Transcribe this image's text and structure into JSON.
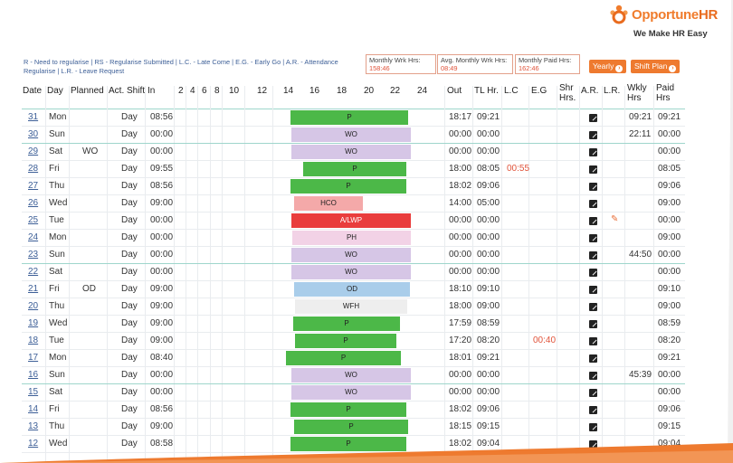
{
  "brand": {
    "name_main": "Opportune",
    "name_hr": "HR",
    "tagline": "We Make HR Easy"
  },
  "legend": "R - Need to regularise | RS - Regularise Submitted | L.C. - Late Come | E.G. - Early Go | A.R. - Attendance Regularise | L.R. - Leave Request",
  "stats": [
    {
      "label": "Monthly Wrk Hrs:",
      "value": "158:46"
    },
    {
      "label": "Avg. Monthly Wrk Hrs:",
      "value": "08:49"
    },
    {
      "label": "Monthly Paid Hrs:",
      "value": "162:46"
    }
  ],
  "buttons": {
    "yearly": "Yearly",
    "shift_plan": "Shift Plan",
    "arrow": "›"
  },
  "headers": {
    "date": "Date",
    "day": "Day",
    "planned": "Planned",
    "act_shift": "Act. Shift",
    "in": "In",
    "timeline": [
      "2",
      "4",
      "6",
      "8",
      "10",
      "12",
      "14",
      "16",
      "18",
      "20",
      "22",
      "24"
    ],
    "out": "Out",
    "tl_hr": "TL Hr.",
    "lc": "L.C",
    "eg": "E.G",
    "shr_hrs_1": "Shr",
    "shr_hrs_2": "Hrs.",
    "ar": "A.R.",
    "lr": "L.R.",
    "wkly_1": "Wkly",
    "wkly_2": "Hrs",
    "paid_1": "Paid",
    "paid_2": "Hrs"
  },
  "colors": {
    "P": "#4cb848",
    "WO": "#d6c6e6",
    "HCO": "#f4a9a9",
    "A/LWP": "#e93d3d",
    "PH": "#f2d2e6",
    "OD": "#a9cdea",
    "WFH": "#eeeeee"
  },
  "rows": [
    {
      "date": "31",
      "day": "Mon",
      "planned": "",
      "shift": "Day",
      "in": "08:56",
      "status": "P",
      "out": "18:17",
      "tl": "09:21",
      "lc": "",
      "eg": "",
      "ar": true,
      "lr": false,
      "wkly": "09:21",
      "paid": "09:21"
    },
    {
      "date": "30",
      "day": "Sun",
      "planned": "",
      "shift": "Day",
      "in": "00:00",
      "status": "WO",
      "out": "00:00",
      "tl": "00:00",
      "lc": "",
      "eg": "",
      "ar": true,
      "lr": false,
      "wkly": "22:11",
      "paid": "00:00"
    },
    {
      "date": "29",
      "day": "Sat",
      "planned": "WO",
      "shift": "Day",
      "in": "00:00",
      "status": "WO",
      "out": "00:00",
      "tl": "00:00",
      "lc": "",
      "eg": "",
      "ar": true,
      "lr": false,
      "wkly": "",
      "paid": "00:00"
    },
    {
      "date": "28",
      "day": "Fri",
      "planned": "",
      "shift": "Day",
      "in": "09:55",
      "status": "P",
      "out": "18:00",
      "tl": "08:05",
      "lc": "00:55",
      "eg": "",
      "ar": true,
      "lr": false,
      "wkly": "",
      "paid": "08:05"
    },
    {
      "date": "27",
      "day": "Thu",
      "planned": "",
      "shift": "Day",
      "in": "08:56",
      "status": "P",
      "out": "18:02",
      "tl": "09:06",
      "lc": "",
      "eg": "",
      "ar": true,
      "lr": false,
      "wkly": "",
      "paid": "09:06"
    },
    {
      "date": "26",
      "day": "Wed",
      "planned": "",
      "shift": "Day",
      "in": "09:00",
      "status": "HCO",
      "out": "14:00",
      "tl": "05:00",
      "lc": "",
      "eg": "",
      "ar": true,
      "lr": false,
      "wkly": "",
      "paid": "09:00"
    },
    {
      "date": "25",
      "day": "Tue",
      "planned": "",
      "shift": "Day",
      "in": "00:00",
      "status": "A/LWP",
      "out": "00:00",
      "tl": "00:00",
      "lc": "",
      "eg": "",
      "ar": true,
      "lr": true,
      "wkly": "",
      "paid": "00:00"
    },
    {
      "date": "24",
      "day": "Mon",
      "planned": "",
      "shift": "Day",
      "in": "00:00",
      "status": "PH",
      "out": "00:00",
      "tl": "00:00",
      "lc": "",
      "eg": "",
      "ar": true,
      "lr": false,
      "wkly": "",
      "paid": "09:00"
    },
    {
      "date": "23",
      "day": "Sun",
      "planned": "",
      "shift": "Day",
      "in": "00:00",
      "status": "WO",
      "out": "00:00",
      "tl": "00:00",
      "lc": "",
      "eg": "",
      "ar": true,
      "lr": false,
      "wkly": "44:50",
      "paid": "00:00"
    },
    {
      "date": "22",
      "day": "Sat",
      "planned": "",
      "shift": "Day",
      "in": "00:00",
      "status": "WO",
      "out": "00:00",
      "tl": "00:00",
      "lc": "",
      "eg": "",
      "ar": true,
      "lr": false,
      "wkly": "",
      "paid": "00:00"
    },
    {
      "date": "21",
      "day": "Fri",
      "planned": "OD",
      "shift": "Day",
      "in": "09:00",
      "status": "OD",
      "out": "18:10",
      "tl": "09:10",
      "lc": "",
      "eg": "",
      "ar": true,
      "lr": false,
      "wkly": "",
      "paid": "09:10"
    },
    {
      "date": "20",
      "day": "Thu",
      "planned": "",
      "shift": "Day",
      "in": "09:00",
      "status": "WFH",
      "out": "18:00",
      "tl": "09:00",
      "lc": "",
      "eg": "",
      "ar": true,
      "lr": false,
      "wkly": "",
      "paid": "09:00"
    },
    {
      "date": "19",
      "day": "Wed",
      "planned": "",
      "shift": "Day",
      "in": "09:00",
      "status": "P",
      "out": "17:59",
      "tl": "08:59",
      "lc": "",
      "eg": "",
      "ar": true,
      "lr": false,
      "wkly": "",
      "paid": "08:59"
    },
    {
      "date": "18",
      "day": "Tue",
      "planned": "",
      "shift": "Day",
      "in": "09:00",
      "status": "P",
      "out": "17:20",
      "tl": "08:20",
      "lc": "",
      "eg": "00:40",
      "ar": true,
      "lr": false,
      "wkly": "",
      "paid": "08:20"
    },
    {
      "date": "17",
      "day": "Mon",
      "planned": "",
      "shift": "Day",
      "in": "08:40",
      "status": "P",
      "out": "18:01",
      "tl": "09:21",
      "lc": "",
      "eg": "",
      "ar": true,
      "lr": false,
      "wkly": "",
      "paid": "09:21"
    },
    {
      "date": "16",
      "day": "Sun",
      "planned": "",
      "shift": "Day",
      "in": "00:00",
      "status": "WO",
      "out": "00:00",
      "tl": "00:00",
      "lc": "",
      "eg": "",
      "ar": true,
      "lr": false,
      "wkly": "45:39",
      "paid": "00:00"
    },
    {
      "date": "15",
      "day": "Sat",
      "planned": "",
      "shift": "Day",
      "in": "00:00",
      "status": "WO",
      "out": "00:00",
      "tl": "00:00",
      "lc": "",
      "eg": "",
      "ar": true,
      "lr": false,
      "wkly": "",
      "paid": "00:00"
    },
    {
      "date": "14",
      "day": "Fri",
      "planned": "",
      "shift": "Day",
      "in": "08:56",
      "status": "P",
      "out": "18:02",
      "tl": "09:06",
      "lc": "",
      "eg": "",
      "ar": true,
      "lr": false,
      "wkly": "",
      "paid": "09:06"
    },
    {
      "date": "13",
      "day": "Thu",
      "planned": "",
      "shift": "Day",
      "in": "09:00",
      "status": "P",
      "out": "18:15",
      "tl": "09:15",
      "lc": "",
      "eg": "",
      "ar": true,
      "lr": false,
      "wkly": "",
      "paid": "09:15"
    },
    {
      "date": "12",
      "day": "Wed",
      "planned": "",
      "shift": "Day",
      "in": "08:58",
      "status": "P",
      "out": "18:02",
      "tl": "09:04",
      "lc": "",
      "eg": "",
      "ar": true,
      "lr": false,
      "wkly": "",
      "paid": "09:04"
    }
  ]
}
